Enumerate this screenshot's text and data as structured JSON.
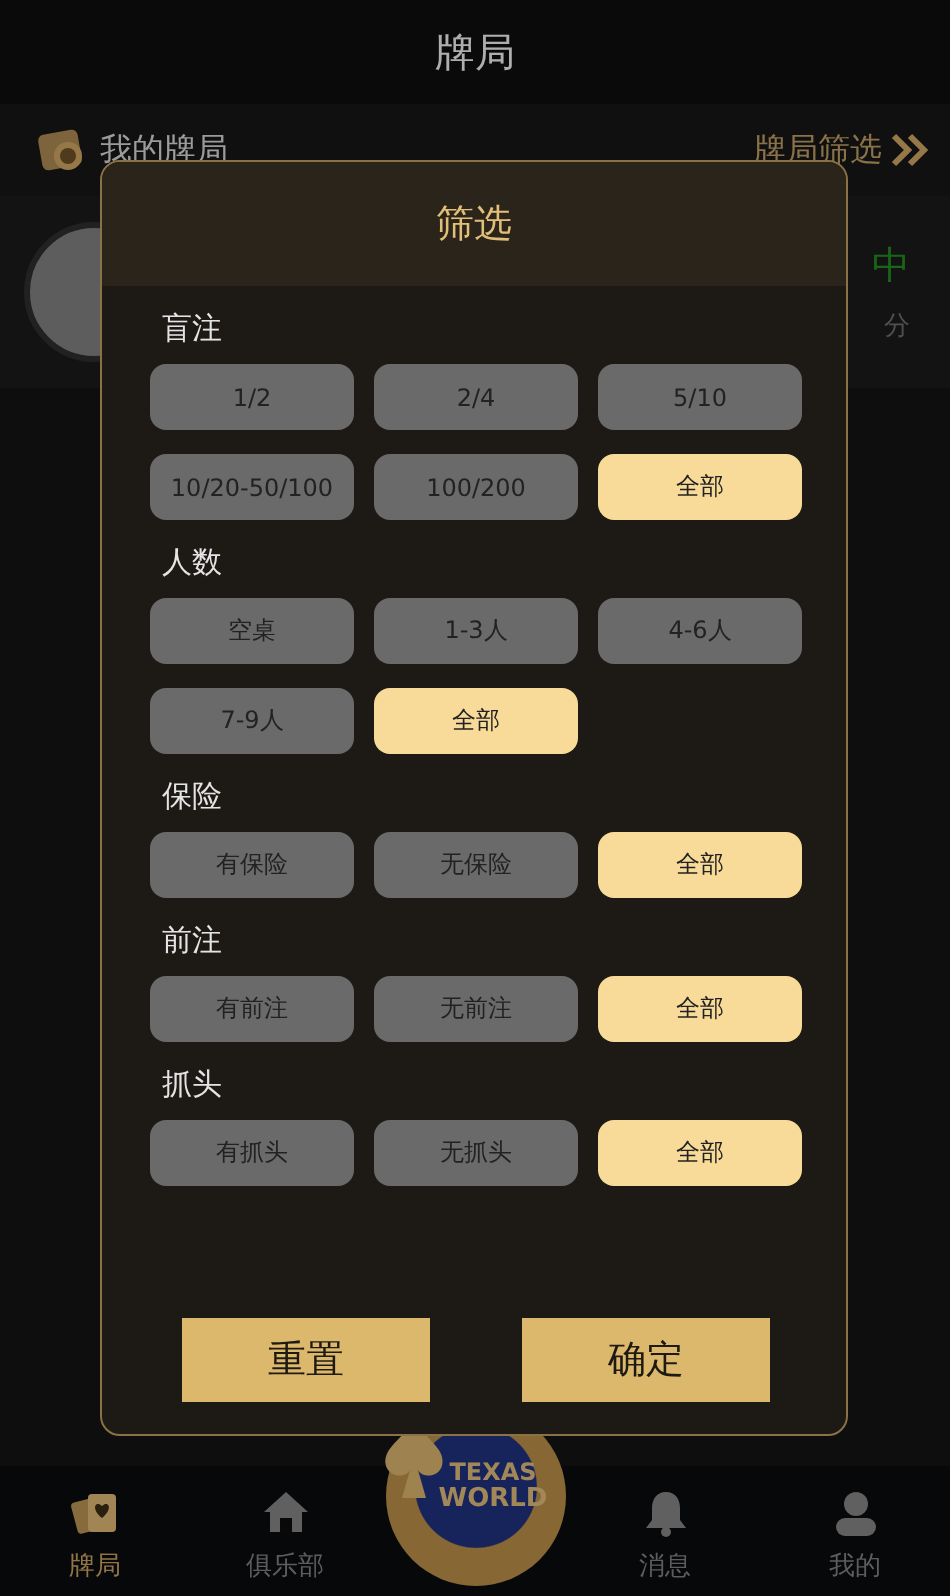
{
  "app_bar": {
    "title": "牌局"
  },
  "sub_bar": {
    "title": "我的牌局",
    "filter_link": "牌局筛选"
  },
  "background_card": {
    "status": "中",
    "detail": "分"
  },
  "filter_dialog": {
    "title": "筛选",
    "groups": [
      {
        "label": "盲注",
        "options": [
          {
            "label": "1/2",
            "selected": false
          },
          {
            "label": "2/4",
            "selected": false
          },
          {
            "label": "5/10",
            "selected": false
          },
          {
            "label": "10/20-50/100",
            "selected": false
          },
          {
            "label": "100/200",
            "selected": false
          },
          {
            "label": "全部",
            "selected": true
          }
        ]
      },
      {
        "label": "人数",
        "options": [
          {
            "label": "空桌",
            "selected": false
          },
          {
            "label": "1-3人",
            "selected": false
          },
          {
            "label": "4-6人",
            "selected": false
          },
          {
            "label": "7-9人",
            "selected": false
          },
          {
            "label": "全部",
            "selected": true
          }
        ]
      },
      {
        "label": "保险",
        "options": [
          {
            "label": "有保险",
            "selected": false
          },
          {
            "label": "无保险",
            "selected": false
          },
          {
            "label": "全部",
            "selected": true
          }
        ]
      },
      {
        "label": "前注",
        "options": [
          {
            "label": "有前注",
            "selected": false
          },
          {
            "label": "无前注",
            "selected": false
          },
          {
            "label": "全部",
            "selected": true
          }
        ]
      },
      {
        "label": "抓头",
        "options": [
          {
            "label": "有抓头",
            "selected": false
          },
          {
            "label": "无抓头",
            "selected": false
          },
          {
            "label": "全部",
            "selected": true
          }
        ]
      }
    ],
    "buttons": [
      {
        "label": "重置"
      },
      {
        "label": "确定"
      }
    ]
  },
  "tab_bar": {
    "items": [
      {
        "label": "牌局",
        "selected": true
      },
      {
        "label": "俱乐部",
        "selected": false
      },
      {
        "label": "消息",
        "selected": false
      },
      {
        "label": "我的",
        "selected": false
      }
    ],
    "logo": {
      "line_1": "TEXAS",
      "line_2": "WORLD"
    }
  }
}
